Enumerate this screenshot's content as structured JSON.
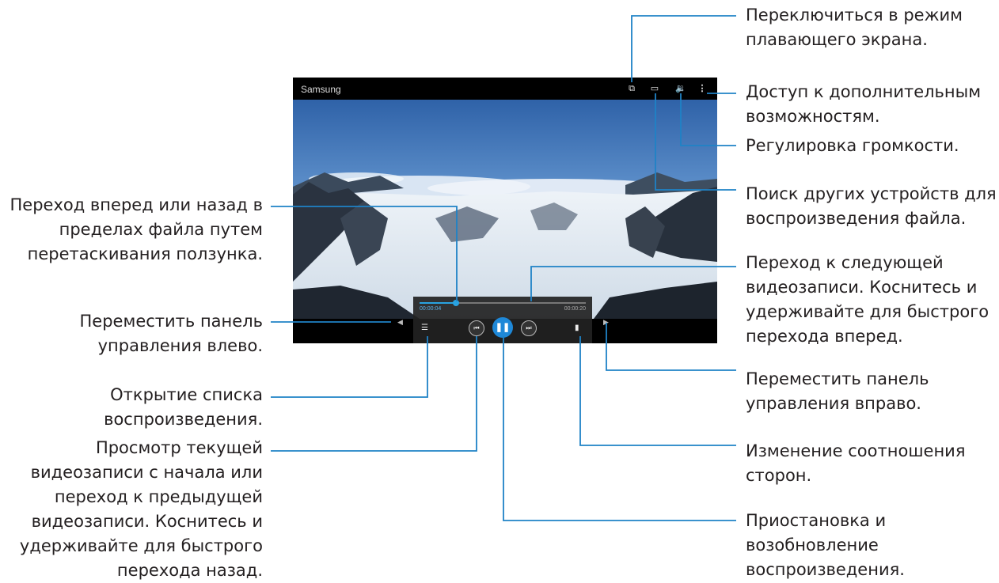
{
  "player": {
    "app_title": "Samsung",
    "current_time": "00:00:04",
    "total_time": "00:00:20",
    "progress": 0.22,
    "accent_color": "#1e88d8",
    "icons": [
      "pop-up-player-icon",
      "screen-mirroring-icon",
      "volume-icon",
      "more-options-icon",
      "playlist-icon",
      "previous-icon",
      "pause-icon",
      "next-icon",
      "aspect-ratio-icon",
      "move-left-arrow-icon",
      "move-right-arrow-icon"
    ]
  },
  "callouts": {
    "popup": "Переключиться в режим\nплавающего экрана.",
    "more": "Доступ к дополнительным\nвозможностям.",
    "volume": "Регулировка громкости.",
    "devices": "Поиск других устройств для\nвоспроизведения файла.",
    "next": "Переход к следующей\nвидеозаписи. Коснитесь и\nудерживайте для быстрого\nперехода вперед.",
    "move_right": "Переместить панель\nуправления вправо.",
    "aspect": "Изменение соотношения\nсторон.",
    "pause": "Приостановка и\nвозобновление\nвоспроизведения.",
    "seek": "Переход вперед или назад в\nпределах файла путем\nперетаскивания ползунка.",
    "move_left": "Переместить панель\nуправления влево.",
    "playlist": "Открытие списка\nвоспроизведения.",
    "previous": "Просмотр текущей\nвидеозаписи с начала или\nпереход к предыдущей\nвидеозаписи. Коснитесь и\nудерживайте для быстрого\nперехода назад."
  }
}
